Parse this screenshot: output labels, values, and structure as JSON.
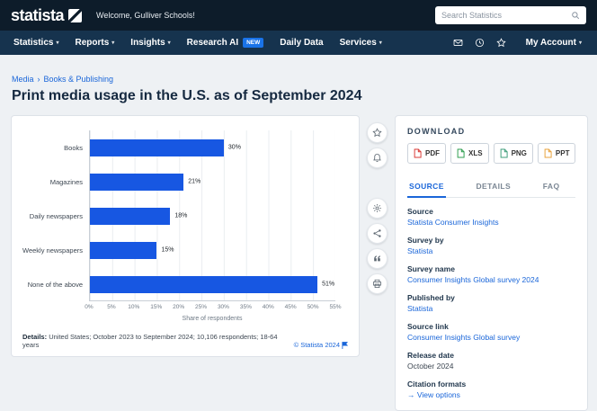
{
  "header": {
    "logo": "statista",
    "welcome": "Welcome, Gulliver Schools!",
    "search_placeholder": "Search Statistics"
  },
  "nav": {
    "items": [
      {
        "label": "Statistics",
        "dropdown": true
      },
      {
        "label": "Reports",
        "dropdown": true
      },
      {
        "label": "Insights",
        "dropdown": true
      },
      {
        "label": "Research AI",
        "badge": "NEW"
      },
      {
        "label": "Daily Data"
      },
      {
        "label": "Services",
        "dropdown": true
      }
    ],
    "icons": [
      {
        "name": "contact",
        "icon": "mail"
      },
      {
        "name": "recently-viewed",
        "icon": "history"
      },
      {
        "name": "favorites",
        "icon": "star"
      }
    ],
    "account_label": "My Account"
  },
  "breadcrumb": {
    "items": [
      "Media",
      "Books & Publishing"
    ],
    "separator": "›"
  },
  "page_title": "Print media usage in the U.S. as of September 2024",
  "chart_data": {
    "type": "bar",
    "orientation": "horizontal",
    "categories": [
      "Books",
      "Magazines",
      "Daily newspapers",
      "Weekly newspapers",
      "None of the above"
    ],
    "values": [
      30,
      21,
      18,
      15,
      51
    ],
    "value_labels": [
      "30%",
      "21%",
      "18%",
      "15%",
      "51%"
    ],
    "xlabel": "Share of respondents",
    "x_ticks": [
      "0%",
      "5%",
      "10%",
      "15%",
      "20%",
      "25%",
      "30%",
      "35%",
      "40%",
      "45%",
      "50%",
      "55%"
    ],
    "xlim": [
      0,
      55
    ],
    "grid": "vertical",
    "legend": "none",
    "bar_color": "#1757e2"
  },
  "chart_footer": {
    "details_label": "Details:",
    "details_text": "United States; October 2023 to September 2024; 10,106 respondents; 18-64 years",
    "copyright": "© Statista 2024"
  },
  "chart_actions": [
    {
      "name": "favorite",
      "icon": "star"
    },
    {
      "name": "alerts",
      "icon": "bell"
    },
    {
      "name": "settings",
      "icon": "gear",
      "group_start": true
    },
    {
      "name": "share",
      "icon": "share"
    },
    {
      "name": "cite",
      "icon": "quote"
    },
    {
      "name": "print",
      "icon": "print"
    }
  ],
  "download": {
    "title": "DOWNLOAD",
    "buttons": [
      {
        "label": "PDF",
        "color": "#d93a35"
      },
      {
        "label": "XLS",
        "color": "#2e9e4f"
      },
      {
        "label": "PNG",
        "color": "#3f9e7b"
      },
      {
        "label": "PPT",
        "color": "#e8a33d"
      }
    ]
  },
  "tabs": [
    {
      "label": "SOURCE",
      "active": true
    },
    {
      "label": "DETAILS",
      "active": false
    },
    {
      "label": "FAQ",
      "active": false
    }
  ],
  "source_panel": {
    "fields": [
      {
        "label": "Source",
        "value": "Statista Consumer Insights",
        "link": true
      },
      {
        "label": "Survey by",
        "value": "Statista",
        "link": true
      },
      {
        "label": "Survey name",
        "value": "Consumer Insights Global survey 2024",
        "link": true
      },
      {
        "label": "Published by",
        "value": "Statista",
        "link": true
      },
      {
        "label": "Source link",
        "value": "Consumer Insights Global survey",
        "link": true
      },
      {
        "label": "Release date",
        "value": "October 2024",
        "link": false
      },
      {
        "label": "Citation formats",
        "value": "→ View options",
        "link": true
      }
    ]
  },
  "colors": {
    "header_bg": "#0d1c2a",
    "nav_bg": "#16334e",
    "accent_blue": "#1a73e8",
    "link_blue": "#1a66d9",
    "bar_blue": "#1757e2"
  }
}
